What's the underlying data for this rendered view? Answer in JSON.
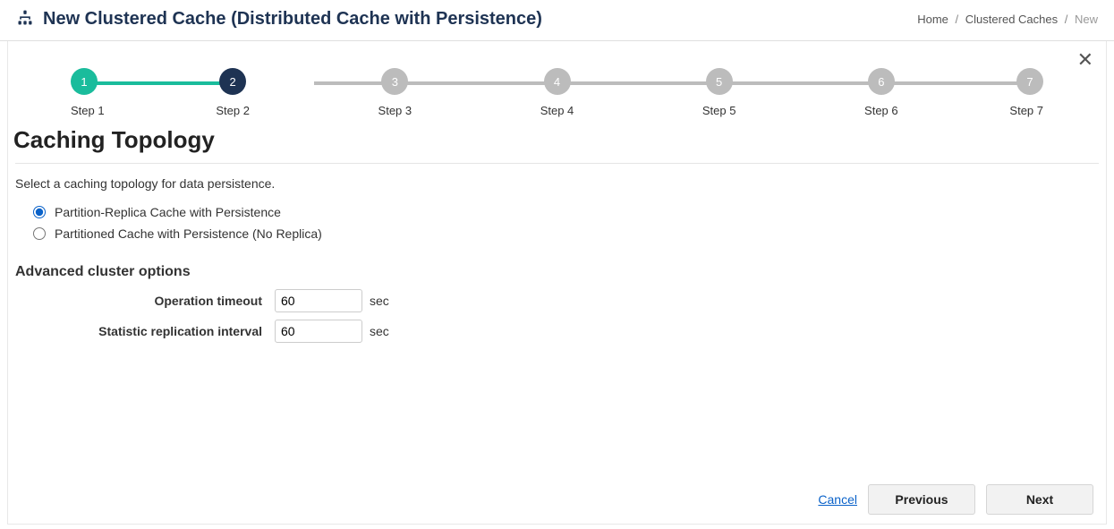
{
  "header": {
    "title": "New Clustered Cache (Distributed Cache with Persistence)"
  },
  "breadcrumb": {
    "home": "Home",
    "mid": "Clustered Caches",
    "current": "New"
  },
  "stepper": {
    "steps": [
      {
        "num": "1",
        "label": "Step 1"
      },
      {
        "num": "2",
        "label": "Step 2"
      },
      {
        "num": "3",
        "label": "Step 3"
      },
      {
        "num": "4",
        "label": "Step 4"
      },
      {
        "num": "5",
        "label": "Step 5"
      },
      {
        "num": "6",
        "label": "Step 6"
      },
      {
        "num": "7",
        "label": "Step 7"
      }
    ]
  },
  "page": {
    "section_title": "Caching Topology",
    "instruction": "Select a caching topology for data persistence.",
    "radios": {
      "opt1": "Partition-Replica Cache with Persistence",
      "opt2": "Partitioned Cache with Persistence (No Replica)"
    },
    "advanced_title": "Advanced cluster options",
    "fields": {
      "op_timeout_label": "Operation timeout",
      "op_timeout_value": "60",
      "op_timeout_unit": "sec",
      "stat_repl_label": "Statistic replication interval",
      "stat_repl_value": "60",
      "stat_repl_unit": "sec"
    }
  },
  "footer": {
    "cancel": "Cancel",
    "previous": "Previous",
    "next": "Next"
  }
}
